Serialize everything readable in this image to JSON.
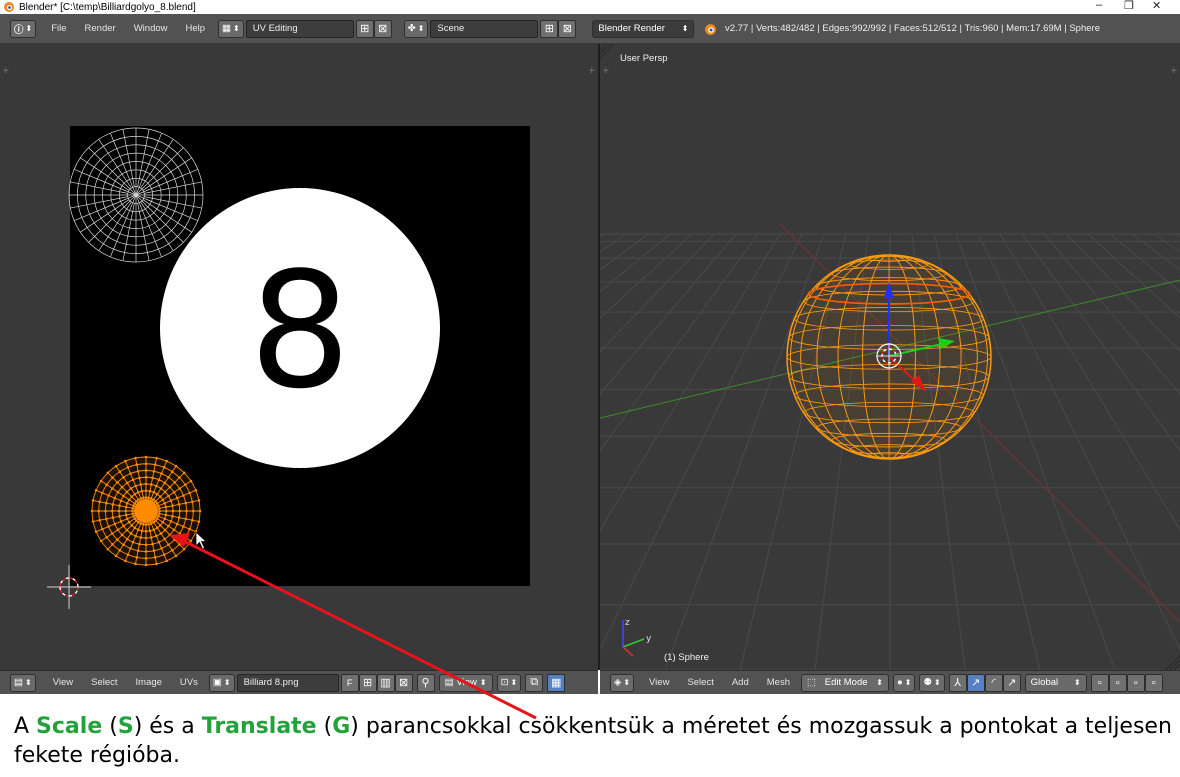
{
  "window": {
    "title": "Blender* [C:\\temp\\Billiardgolyo_8.blend]",
    "minimize": "–",
    "restore": "❐",
    "close": "✕"
  },
  "topbar": {
    "menus": [
      "File",
      "Render",
      "Window",
      "Help"
    ],
    "layout_name": "UV Editing",
    "scene_name": "Scene",
    "engine": "Blender Render",
    "stats": "v2.77 | Verts:482/482 | Edges:992/992 | Faces:512/512 | Tris:960 | Mem:17.69M | Sphere"
  },
  "uv_editor": {
    "texture_label": "8"
  },
  "view3d": {
    "label": "User Persp",
    "object_label": "(1) Sphere",
    "axis_z": "z",
    "axis_y": "y"
  },
  "uv_footer": {
    "menus": [
      "View",
      "Select",
      "Image",
      "UVs"
    ],
    "image_name": "Billiard 8.png",
    "fake_user": "F",
    "view_label": "View"
  },
  "v3d_footer": {
    "menus": [
      "View",
      "Select",
      "Add",
      "Mesh"
    ],
    "mode": "Edit Mode",
    "orientation": "Global"
  },
  "caption": {
    "p1": "A ",
    "scale": "Scale",
    "p2": " (",
    "s": "S",
    "p3": ") és a ",
    "translate": "Translate",
    "p4": " (",
    "g": "G",
    "p5": ") parancsokkal csökkentsük a méretet és mozgassuk a pontokat a teljesen fekete régióba."
  },
  "colors": {
    "header_bg": "#525252",
    "viewport_bg": "#393939",
    "selection_orange": "#ff8c00",
    "highlight_green": "#21a33a",
    "arrow_red": "#e8121b"
  }
}
